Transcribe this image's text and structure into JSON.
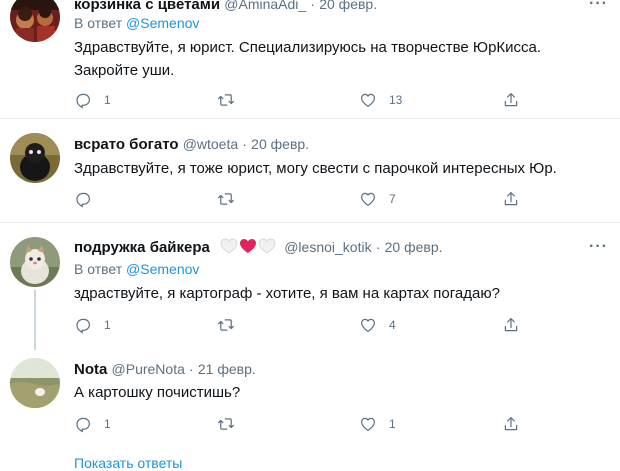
{
  "tweets": [
    {
      "name": "корзинка с цветами",
      "handle": "@AminaAdi_",
      "date": "20 февр.",
      "reply_prefix": "В ответ",
      "reply_to": "@Semenov",
      "text": "Здравствуйте, я юрист. Специализируюсь на творчестве ЮрКисса. Закройте уши.",
      "replies": "1",
      "retweets": "",
      "likes": "13"
    },
    {
      "name": "всрато богато",
      "handle": "@wtoeta",
      "date": "20 февр.",
      "text": "Здравствуйте, я тоже юрист, могу свести с парочкой интересных Юр.",
      "replies": "",
      "retweets": "",
      "likes": "7"
    },
    {
      "name": "подружка байкера",
      "handle": "@lesnoi_kotik",
      "date": "20 февр.",
      "reply_prefix": "В ответ",
      "reply_to": "@Semenov",
      "text": "здраствуйте, я картограф - хотите, я вам на картах погадаю?",
      "replies": "1",
      "retweets": "",
      "likes": "4"
    },
    {
      "name": "Nota",
      "handle": "@PureNota",
      "date": "21 февр.",
      "text": "А картошку почистишь?",
      "replies": "1",
      "retweets": "",
      "likes": "1"
    }
  ],
  "separator": "·",
  "more_label": "···",
  "show_replies": "Показать ответы",
  "icons": {
    "reply": "reply-icon",
    "retweet": "retweet-icon",
    "like": "heart-icon",
    "share": "share-icon",
    "more": "more-icon"
  },
  "colors": {
    "text": "#0f1419",
    "secondary": "#5b7083",
    "link": "#1b95e0",
    "divider": "#e6ecf0",
    "heart_red": "#e0245e"
  }
}
